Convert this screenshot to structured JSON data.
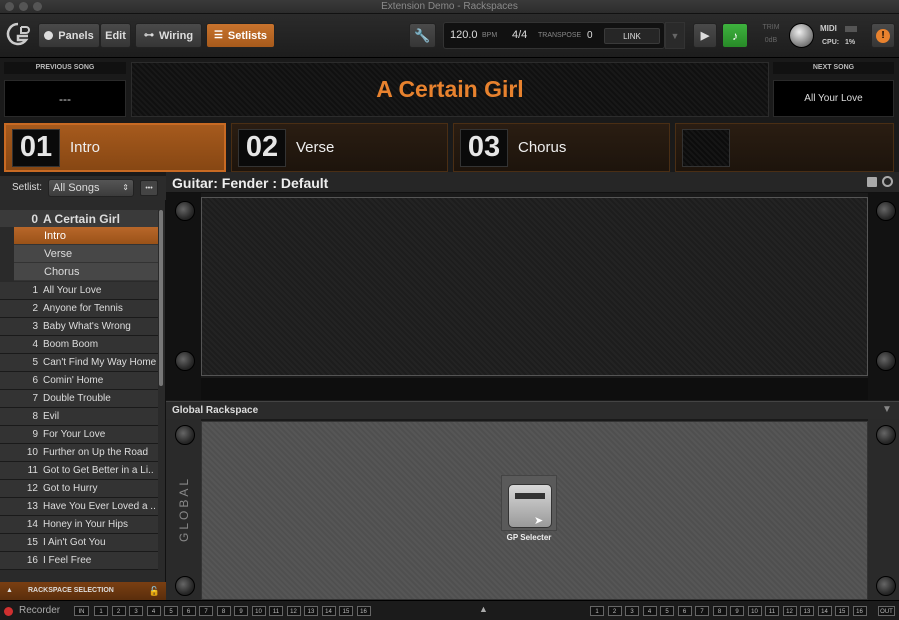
{
  "window": {
    "title": "Extension Demo - Rackspaces"
  },
  "toolbar": {
    "panels_label": "Panels",
    "edit_label": "Edit",
    "wiring_label": "Wiring",
    "setlists_label": "Setlists",
    "tempo": "120.0",
    "bpm_label": "BPM",
    "time_signature": "4/4",
    "transpose_label": "TRANSPOSE",
    "transpose_value": "0",
    "link_label": "LINK",
    "trim_label": "TRIM",
    "trim_value": "0dB",
    "midi_label": "MIDI",
    "cpu_label": "CPU:",
    "cpu_value": "1%"
  },
  "song_header": {
    "previous_label": "PREVIOUS SONG",
    "previous_value": "---",
    "current_song": "A Certain Girl",
    "next_label": "NEXT SONG",
    "next_value": "All Your Love"
  },
  "parts": [
    {
      "num": "01",
      "name": "Intro"
    },
    {
      "num": "02",
      "name": "Verse"
    },
    {
      "num": "03",
      "name": "Chorus"
    }
  ],
  "sidebar": {
    "setlist_label": "Setlist:",
    "setlist_value": "All Songs",
    "more_label": "•••",
    "current": {
      "num": "0",
      "name": "A Certain Girl",
      "parts": [
        "Intro",
        "Verse",
        "Chorus"
      ]
    },
    "songs": [
      {
        "num": "1",
        "name": "All Your Love"
      },
      {
        "num": "2",
        "name": "Anyone for Tennis"
      },
      {
        "num": "3",
        "name": "Baby What's Wrong"
      },
      {
        "num": "4",
        "name": "Boom Boom"
      },
      {
        "num": "5",
        "name": "Can't Find My Way Home"
      },
      {
        "num": "6",
        "name": "Comin' Home"
      },
      {
        "num": "7",
        "name": "Double Trouble"
      },
      {
        "num": "8",
        "name": "Evil"
      },
      {
        "num": "9",
        "name": "For Your Love"
      },
      {
        "num": "10",
        "name": "Further on Up the Road"
      },
      {
        "num": "11",
        "name": "Got to Get Better in a Li.."
      },
      {
        "num": "12",
        "name": "Got to Hurry"
      },
      {
        "num": "13",
        "name": "Have You Ever Loved a .."
      },
      {
        "num": "14",
        "name": "Honey in Your Hips"
      },
      {
        "num": "15",
        "name": "I Ain't Got You"
      },
      {
        "num": "16",
        "name": "I Feel Free"
      }
    ],
    "rackspace_selection_label": "RACKSPACE SELECTION"
  },
  "rackspace": {
    "title": "Guitar: Fender : Default"
  },
  "global": {
    "title": "Global Rackspace",
    "side_label": "GLOBAL",
    "plugin_label": "GP Selecter"
  },
  "bottom": {
    "recorder_label": "Recorder",
    "in_label": "IN",
    "out_label": "OUT",
    "channels": [
      "1",
      "2",
      "3",
      "4",
      "5",
      "6",
      "7",
      "8",
      "9",
      "10",
      "11",
      "12",
      "13",
      "14",
      "15",
      "16"
    ]
  },
  "colors": {
    "accent": "#e8822e",
    "selected_part": "#a65a1d"
  }
}
